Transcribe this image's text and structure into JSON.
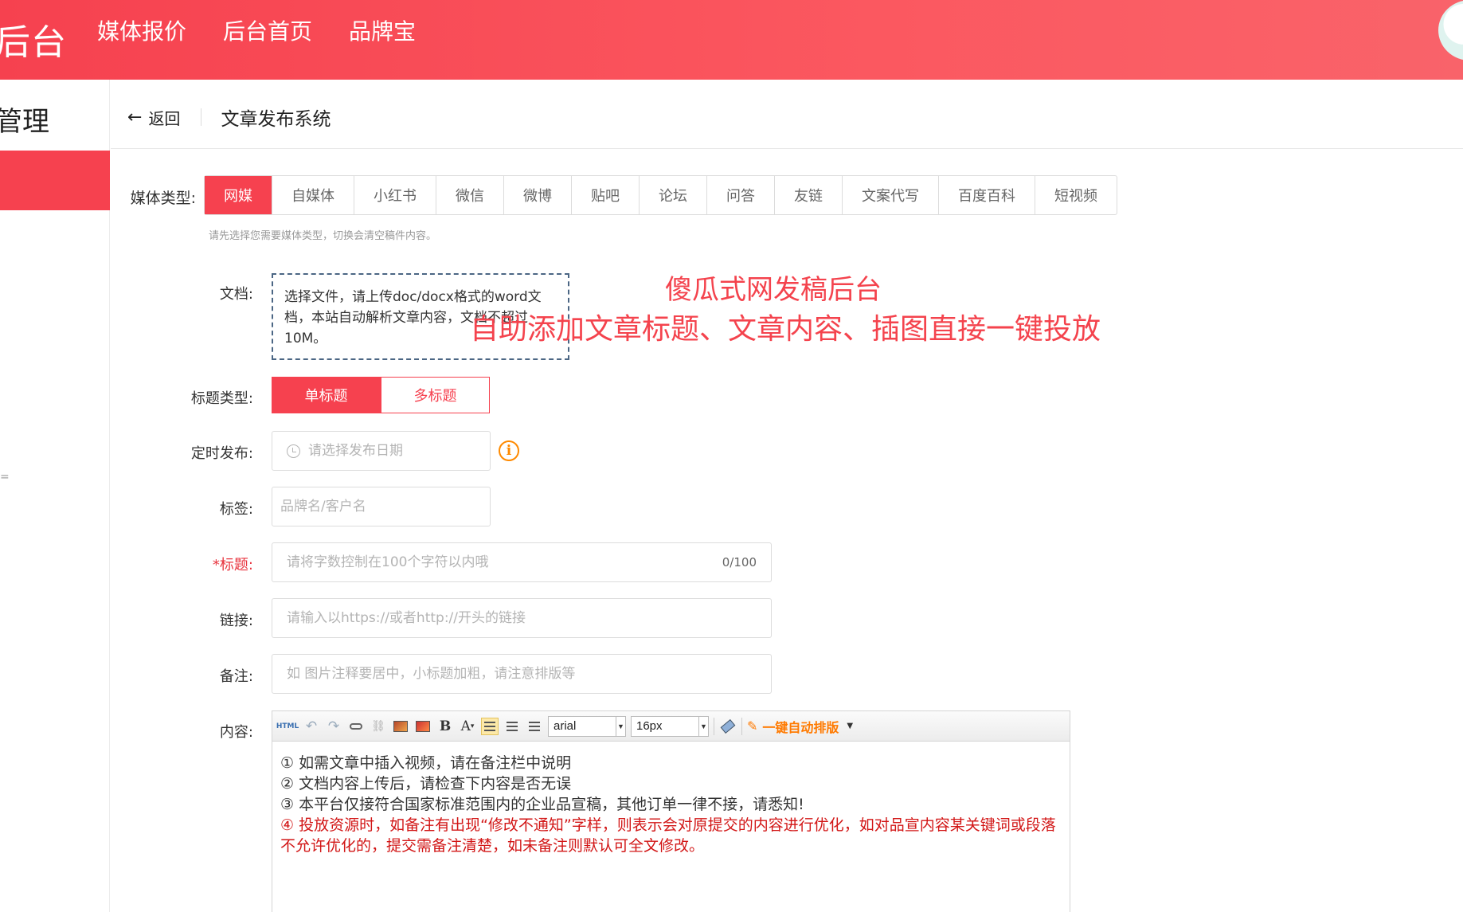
{
  "header": {
    "brand_partial": "后台",
    "nav": [
      "媒体报价",
      "后台首页",
      "品牌宝"
    ]
  },
  "sidebar": {
    "title_partial": "管理",
    "dot": "="
  },
  "breadcrumb": {
    "back": "返回",
    "title": "文章发布系统"
  },
  "form": {
    "media_type": {
      "label": "媒体类型:",
      "options": [
        "网媒",
        "自媒体",
        "小红书",
        "微信",
        "微博",
        "贴吧",
        "论坛",
        "问答",
        "友链",
        "文案代写",
        "百度百科",
        "短视频"
      ],
      "selected": "网媒",
      "hint": "请先选择您需要媒体类型，切换会清空稿件内容。"
    },
    "document": {
      "label": "文档:",
      "upload_text": "选择文件，请上传doc/docx格式的word文档，本站自动解析文章内容，文档不超过10M。"
    },
    "title_type": {
      "label": "标题类型:",
      "options": [
        "单标题",
        "多标题"
      ],
      "selected": "单标题"
    },
    "schedule": {
      "label": "定时发布:",
      "placeholder": "请选择发布日期"
    },
    "tags": {
      "label": "标签:",
      "placeholder": "品牌名/客户名"
    },
    "title": {
      "required_mark": "*",
      "label": "标题:",
      "placeholder": "请将字数控制在100个字符以内哦",
      "counter": "0/100"
    },
    "link": {
      "label": "链接:",
      "placeholder": "请输入以https://或者http://开头的链接"
    },
    "remark": {
      "label": "备注:",
      "placeholder": "如 图片注释要居中，小标题加粗，请注意排版等"
    },
    "content": {
      "label": "内容:",
      "toolbar": {
        "html": "HTML",
        "font": "arial",
        "size": "16px",
        "auto_format": "一键自动排版"
      },
      "lines": [
        "① 如需文章中插入视频，请在备注栏中说明",
        "② 文档内容上传后，请检查下内容是否无误",
        "③ 本平台仅接符合国家标准范围内的企业品宣稿，其他订单一律不接，请悉知!"
      ],
      "warning": "④ 投放资源时，如备注有出现“修改不通知”字样，则表示会对原提交的内容进行优化，如对品宣内容某关键词或段落不允许优化的，提交需备注清楚，如未备注则默认可全文修改。"
    }
  },
  "overlay": {
    "line1": "傻瓜式网发稿后台",
    "line2": "自助添加文章标题、文章内容、插图直接一键投放"
  },
  "colors": {
    "accent": "#f6414f",
    "overlay_text": "#f4434d",
    "warning_text": "#d21616",
    "info_icon": "#ff8a00"
  }
}
